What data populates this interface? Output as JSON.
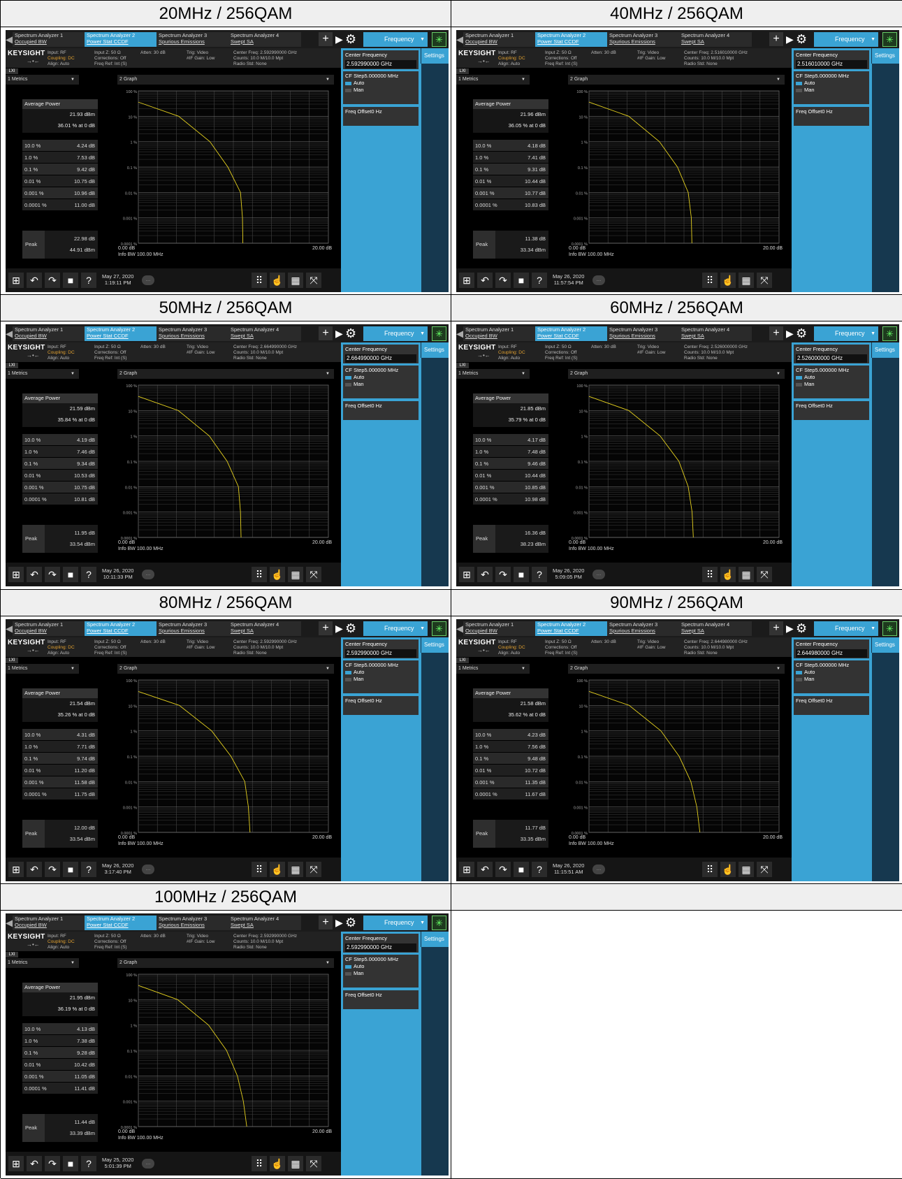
{
  "window": {
    "tabs": [
      {
        "line1": "Spectrum Analyzer 1",
        "line2": "Occupied BW"
      },
      {
        "line1": "Spectrum Analyzer 2",
        "line2": "Power Stat CCDF"
      },
      {
        "line1": "Spectrum Analyzer 3",
        "line2": "Spurious Emissions"
      },
      {
        "line1": "Spectrum Analyzer 4",
        "line2": "Swept SA"
      }
    ],
    "mode_button": "Frequency",
    "logo": "KEYSIGHT",
    "lxi": "LXI",
    "input": [
      "Input: RF",
      "Coupling: DC",
      "Align: Auto"
    ],
    "input_z": [
      "Input Z: 50 Ω",
      "Corrections: Off",
      "Freq Ref: Int (S)"
    ],
    "atten": "Atten: 30 dB",
    "trig": [
      "Trig: Video",
      "#IF Gain: Low"
    ],
    "radio_std": "Radio Std: None",
    "counts": "Counts: 10.0 M/10.0 Mpt",
    "metrics_dropdown": "1 Metrics",
    "graph_dropdown": "2 Graph",
    "avg_power_label": "Average Power",
    "peak_label": "Peak",
    "settings_tab": "Settings",
    "center_freq_label": "Center Frequency",
    "cf_step_label": "CF Step",
    "cf_step_value": "5.000000 MHz",
    "auto_label": "Auto",
    "man_label": "Man",
    "freq_offset_label": "Freq Offset",
    "freq_offset_value": "0 Hz",
    "y_ticks": [
      "100 %",
      "10 %",
      "1 %",
      "0.1 %",
      "0.01 %",
      "0.001 %",
      "0.0001 %"
    ],
    "x_left": "0.00 dB",
    "x_right": "20.00 dB",
    "info_bw": "Info BW 100.00 MHz",
    "row_labels": [
      "10.0 %",
      "1.0 %",
      "0.1 %",
      "0.01 %",
      "0.001 %",
      "0.0001 %"
    ]
  },
  "panels": [
    {
      "caption": "20MHz / 256QAM",
      "center_freq": "2.592990000 GHz",
      "center_freq_hdr": "Center Freq: 2.592990000 GHz",
      "avg_dbm": "21.93 dBm",
      "avg_pct": "36.01 % at 0 dB",
      "rows": [
        "4.24 dB",
        "7.53 dB",
        "9.42 dB",
        "10.75 dB",
        "10.96 dB",
        "11.00 dB"
      ],
      "peak_db": "22.98 dB",
      "peak_dbm": "44.91 dBm",
      "date": "May 27, 2020",
      "time": "1:19:11 PM"
    },
    {
      "caption": "40MHz / 256QAM",
      "center_freq": "2.516010000 GHz",
      "center_freq_hdr": "Center Freq: 2.516010000 GHz",
      "avg_dbm": "21.96 dBm",
      "avg_pct": "36.05 % at 0 dB",
      "rows": [
        "4.18 dB",
        "7.41 dB",
        "9.31 dB",
        "10.44 dB",
        "10.77 dB",
        "10.83 dB"
      ],
      "peak_db": "11.38 dB",
      "peak_dbm": "33.34 dBm",
      "date": "May 26, 2020",
      "time": "11:57:54 PM"
    },
    {
      "caption": "50MHz / 256QAM",
      "center_freq": "2.664990000 GHz",
      "center_freq_hdr": "Center Freq: 2.664990000 GHz",
      "avg_dbm": "21.59 dBm",
      "avg_pct": "35.84 % at 0 dB",
      "rows": [
        "4.19 dB",
        "7.46 dB",
        "9.34 dB",
        "10.53 dB",
        "10.75 dB",
        "10.81 dB"
      ],
      "peak_db": "11.95 dB",
      "peak_dbm": "33.54 dBm",
      "date": "May 26, 2020",
      "time": "10:11:33 PM"
    },
    {
      "caption": "60MHz / 256QAM",
      "center_freq": "2.526000000 GHz",
      "center_freq_hdr": "Center Freq: 2.526000000 GHz",
      "avg_dbm": "21.85 dBm",
      "avg_pct": "35.79 % at 0 dB",
      "rows": [
        "4.17 dB",
        "7.48 dB",
        "9.46 dB",
        "10.44 dB",
        "10.85 dB",
        "10.98 dB"
      ],
      "peak_db": "16.36 dB",
      "peak_dbm": "38.23 dBm",
      "date": "May 26, 2020",
      "time": "5:09:05 PM"
    },
    {
      "caption": "80MHz / 256QAM",
      "center_freq": "2.592990000 GHz",
      "center_freq_hdr": "Center Freq: 2.592990000 GHz",
      "avg_dbm": "21.54 dBm",
      "avg_pct": "35.26 % at 0 dB",
      "rows": [
        "4.31 dB",
        "7.71 dB",
        "9.74 dB",
        "11.20 dB",
        "11.58 dB",
        "11.75 dB"
      ],
      "peak_db": "12.00 dB",
      "peak_dbm": "33.54 dBm",
      "date": "May 26, 2020",
      "time": "3:17:40 PM"
    },
    {
      "caption": "90MHz / 256QAM",
      "center_freq": "2.644980000 GHz",
      "center_freq_hdr": "Center Freq: 2.644980000 GHz",
      "avg_dbm": "21.58 dBm",
      "avg_pct": "35.62 % at 0 dB",
      "rows": [
        "4.23 dB",
        "7.56 dB",
        "9.48 dB",
        "10.72 dB",
        "11.35 dB",
        "11.67 dB"
      ],
      "peak_db": "11.77 dB",
      "peak_dbm": "33.35 dBm",
      "date": "May 26, 2020",
      "time": "11:15:51 AM"
    },
    {
      "caption": "100MHz / 256QAM",
      "center_freq": "2.592990000 GHz",
      "center_freq_hdr": "Center Freq: 2.592990000 GHz",
      "avg_dbm": "21.95 dBm",
      "avg_pct": "36.19 % at 0 dB",
      "rows": [
        "4.13 dB",
        "7.38 dB",
        "9.28 dB",
        "10.42 dB",
        "11.05 dB",
        "11.41 dB"
      ],
      "peak_db": "11.44 dB",
      "peak_dbm": "33.39 dBm",
      "date": "May 25, 2020",
      "time": "5:01:39 PM"
    }
  ],
  "colors": {
    "accent": "#3aa3d4",
    "trace": "#e6d21e",
    "panel_dark": "#16384f"
  }
}
